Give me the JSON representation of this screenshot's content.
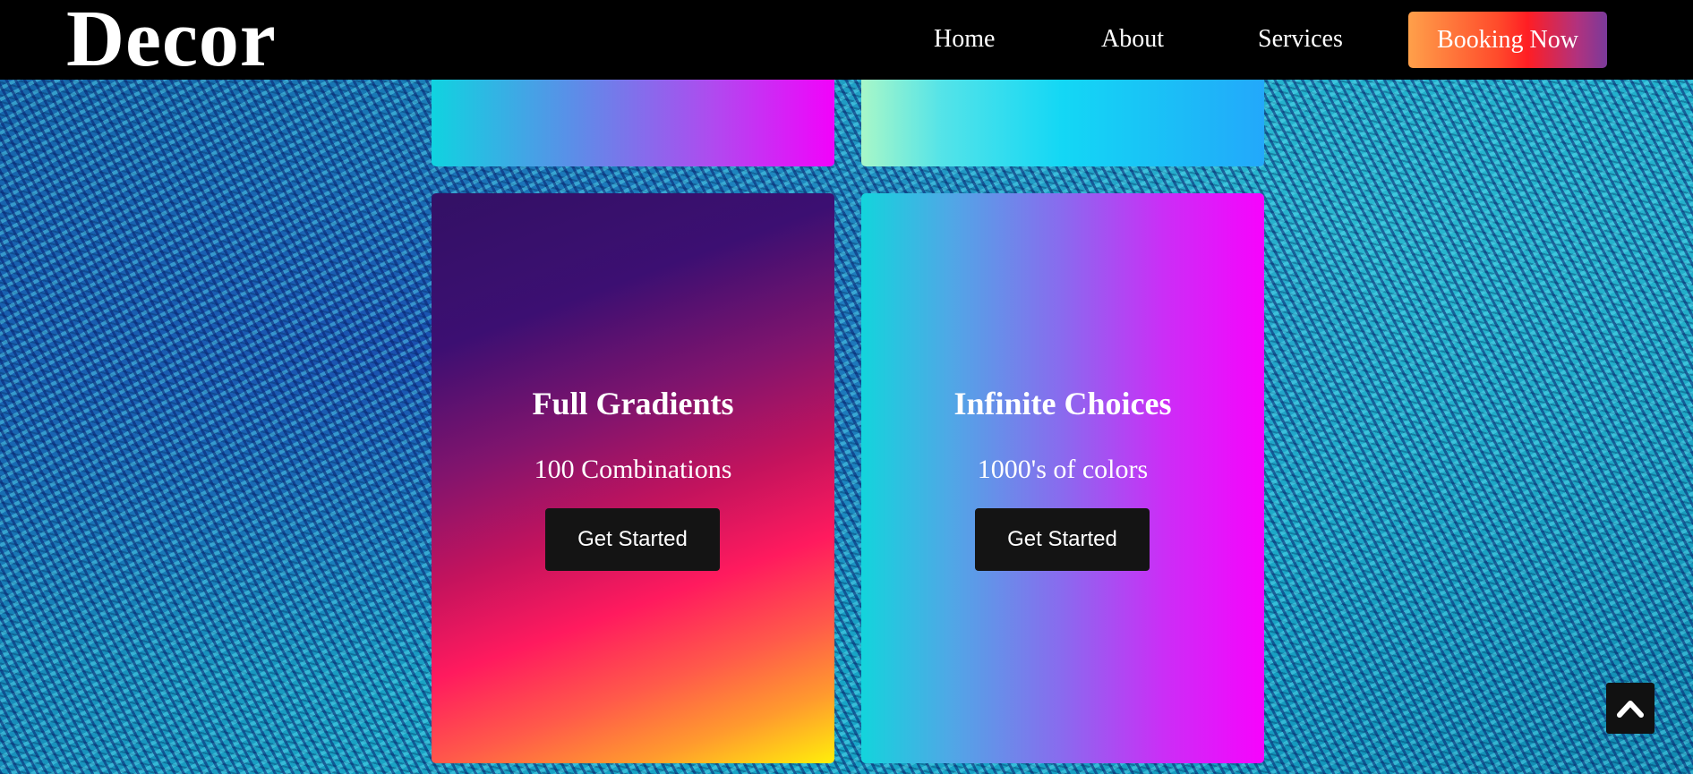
{
  "brand": {
    "logo": "Decor"
  },
  "nav": {
    "home": "Home",
    "about": "About",
    "services": "Services",
    "booking": "Booking Now"
  },
  "cards": [
    {
      "title": "Full Gradients",
      "subtitle": "100 Combinations",
      "button": "Get Started"
    },
    {
      "title": "Infinite Choices",
      "subtitle": "1000's of colors",
      "button": "Get Started"
    }
  ],
  "icons": {
    "back_to_top": "chevron-up-icon"
  },
  "colors": {
    "navbar": "#000000",
    "button_dark": "#141414",
    "booking_gradient_start": "#ffa04a",
    "booking_gradient_end": "#7a3a9a"
  }
}
